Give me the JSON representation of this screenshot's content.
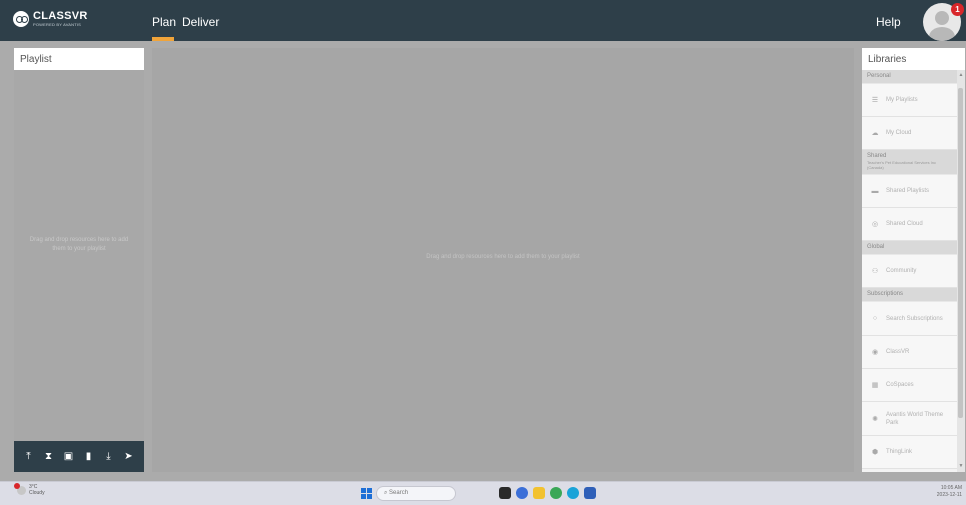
{
  "app": {
    "logo_title": "CLASSVR",
    "logo_subtitle": "POWERED BY AVANTIS"
  },
  "nav": {
    "tabs": [
      {
        "label": "Plan",
        "active": true
      },
      {
        "label": "Deliver",
        "active": false
      }
    ],
    "help_label": "Help",
    "notification_count": "1"
  },
  "playlist": {
    "title": "Playlist",
    "empty_message": "Drag and drop resources here to add them to your playlist"
  },
  "main": {
    "drop_message": "Drag and drop resources here to add them to your playlist"
  },
  "libraries": {
    "title": "Libraries",
    "sections": {
      "personal": "Personal",
      "shared": "Shared",
      "shared_sub": "Teacher's Pet Educational Services Inc (Canada)",
      "global": "Global",
      "subscriptions": "Subscriptions"
    },
    "items": {
      "my_playlists": "My Playlists",
      "my_cloud": "My Cloud",
      "shared_playlists": "Shared Playlists",
      "shared_cloud": "Shared Cloud",
      "community": "Community",
      "search_subscriptions": "Search Subscriptions",
      "classvr": "ClassVR",
      "cospaces": "CoSpaces",
      "avantis_world": "Avantis World Theme Park",
      "thinglink": "ThingLink"
    }
  },
  "taskbar": {
    "weather_temp": "3°C",
    "weather_desc": "Cloudy",
    "search_placeholder": "Search",
    "time": "10:05 AM",
    "date": "2023-12-11"
  },
  "colors": {
    "topbar": "#2e3f49",
    "accent": "#f0a43a",
    "badge": "#d8262a",
    "canvas": "#a6a6a6"
  }
}
